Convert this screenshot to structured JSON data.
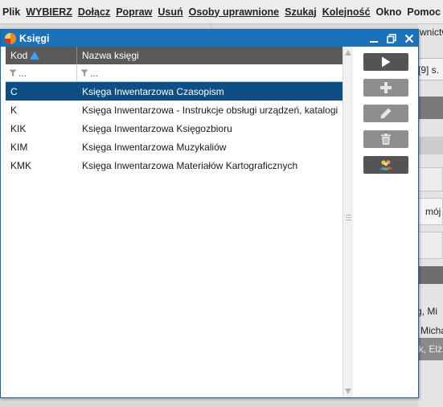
{
  "menubar": {
    "items": [
      "Plik",
      "WYBIERZ",
      "Dołącz",
      "Popraw",
      "Usuń",
      "Osoby uprawnione",
      "Szukaj",
      "Kolejność",
      "Okno",
      "Pomoc"
    ]
  },
  "background": {
    "texts": [
      "wnictw",
      "[9] s.",
      "mój",
      "rg, Mi",
      "Micha",
      "ak, Elż"
    ]
  },
  "dialog": {
    "title": "Księgi",
    "columns": {
      "kod": "Kod",
      "nazwa": "Nazwa księgi"
    },
    "filter": {
      "kod": "...",
      "nazwa": "..."
    },
    "rows": [
      {
        "kod": "C",
        "nazwa": "Księga Inwentarzowa Czasopism",
        "selected": true
      },
      {
        "kod": "K",
        "nazwa": "Księga Inwentarzowa - Instrukcje obsługi urządzeń, katalogi",
        "selected": false
      },
      {
        "kod": "KIK",
        "nazwa": "Księga Inwentarzowa Księgozbioru",
        "selected": false
      },
      {
        "kod": "KIM",
        "nazwa": "Księga Inwentarzowa Muzykaliów",
        "selected": false
      },
      {
        "kod": "KMK",
        "nazwa": "Księga Inwentarzowa Materiałów Kartograficznych",
        "selected": false
      }
    ],
    "actions": [
      {
        "name": "select-button",
        "icon": "play-icon",
        "enabled": true
      },
      {
        "name": "add-button",
        "icon": "plus-icon",
        "enabled": false
      },
      {
        "name": "edit-button",
        "icon": "pencil-icon",
        "enabled": false
      },
      {
        "name": "delete-button",
        "icon": "trash-icon",
        "enabled": false
      },
      {
        "name": "users-button",
        "icon": "users-icon",
        "enabled": true
      }
    ]
  },
  "colors": {
    "titlebar": "#1c72b9",
    "selected_row": "#0d4f85",
    "header": "#5a5a5a",
    "sort_arrow": "#3aa0ff"
  }
}
